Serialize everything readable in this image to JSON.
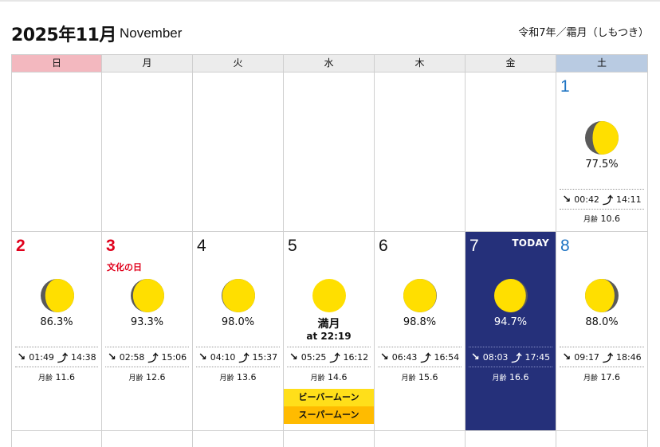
{
  "header": {
    "title": "2025年11月",
    "subtitle": "November",
    "era": "令和7年／霜月（しもつき）"
  },
  "weekdays": [
    "日",
    "月",
    "火",
    "水",
    "木",
    "金",
    "土"
  ],
  "age_label": "月齢",
  "colors": {
    "sunday": "#e0001b",
    "saturday": "#1f74c3",
    "today_bg": "#25307a",
    "moon": "#ffdf00",
    "shadow": "#5a5a5a"
  },
  "days": {
    "d1": {
      "num": "1",
      "pct": "77.5%",
      "moonset": "00:42",
      "moonrise": "14:11",
      "age": "10.6",
      "illum": 0.775,
      "waxing": true
    },
    "d2": {
      "num": "2",
      "pct": "86.3%",
      "moonset": "01:49",
      "moonrise": "14:38",
      "age": "11.6",
      "illum": 0.863,
      "waxing": true
    },
    "d3": {
      "num": "3",
      "holiday": "文化の日",
      "pct": "93.3%",
      "moonset": "02:58",
      "moonrise": "15:06",
      "age": "12.6",
      "illum": 0.933,
      "waxing": true
    },
    "d4": {
      "num": "4",
      "pct": "98.0%",
      "moonset": "04:10",
      "moonrise": "15:37",
      "age": "13.6",
      "illum": 0.98,
      "waxing": true
    },
    "d5": {
      "num": "5",
      "full_label": "満月",
      "full_time": "at 22:19",
      "moonset": "05:25",
      "moonrise": "16:12",
      "age": "14.6",
      "tag1": "ビーバームーン",
      "tag2": "スーパームーン",
      "illum": 1.0,
      "waxing": true
    },
    "d6": {
      "num": "6",
      "pct": "98.8%",
      "moonset": "06:43",
      "moonrise": "16:54",
      "age": "15.6",
      "illum": 0.988,
      "waxing": false
    },
    "d7": {
      "num": "7",
      "today": "TODAY",
      "pct": "94.7%",
      "moonset": "08:03",
      "moonrise": "17:45",
      "age": "16.6",
      "illum": 0.947,
      "waxing": false
    },
    "d8": {
      "num": "8",
      "pct": "88.0%",
      "moonset": "09:17",
      "moonrise": "18:46",
      "age": "17.6",
      "illum": 0.88,
      "waxing": false
    }
  }
}
